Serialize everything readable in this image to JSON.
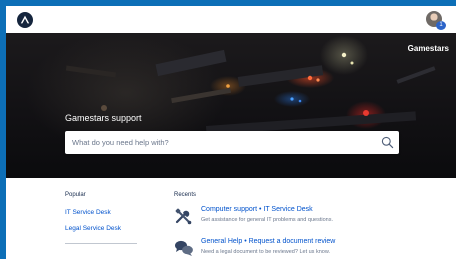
{
  "header": {
    "logo_icon": "atlassian-triangle-logo",
    "avatar_badge": "1"
  },
  "hero": {
    "brand": "Gamestars",
    "title": "Gamestars support",
    "search_placeholder": "What do you need help with?",
    "search_icon": "magnifier-icon"
  },
  "popular": {
    "heading": "Popular",
    "items": [
      {
        "label": "IT Service Desk"
      },
      {
        "label": "Legal Service Desk"
      }
    ]
  },
  "recents": {
    "heading": "Recents",
    "items": [
      {
        "title": "Computer support • IT Service Desk",
        "description": "Get assistance for general IT problems and questions.",
        "icon": "tools-icon"
      },
      {
        "title": "General Help • Request a document review",
        "description": "Need a legal document to be reviewed? Let us know.",
        "icon": "chat-bubbles-icon"
      }
    ]
  },
  "colors": {
    "page_frame": "#0d6fb7",
    "link": "#0052cc",
    "text": "#172b4d",
    "muted": "#6b778c"
  }
}
